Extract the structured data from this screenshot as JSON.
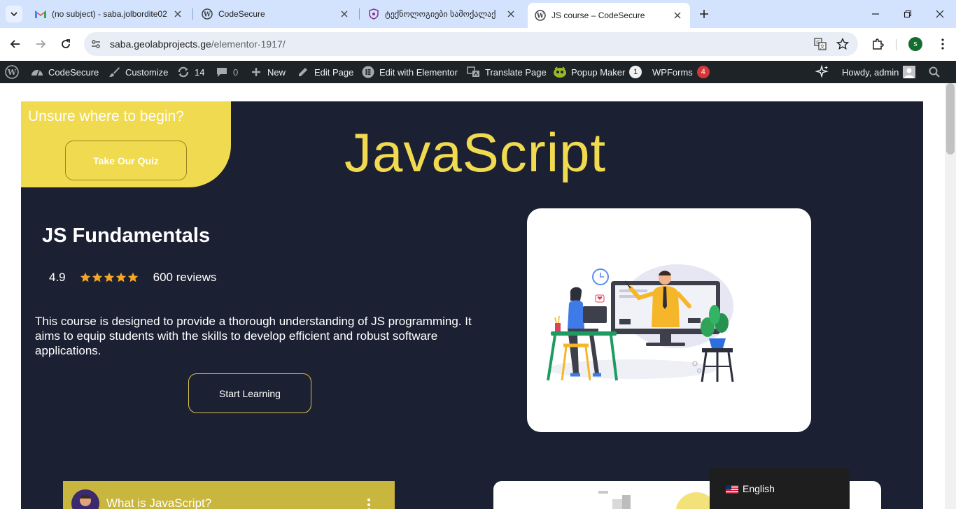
{
  "browser": {
    "tabs": [
      {
        "title": "(no subject) - saba.jolbordite02",
        "favicon": "gmail-icon"
      },
      {
        "title": "CodeSecure",
        "favicon": "wordpress-icon"
      },
      {
        "title": "ტექნოლოგიები სამოქალაქ",
        "favicon": "shield-icon"
      },
      {
        "title": "JS course – CodeSecure",
        "favicon": "wordpress-icon",
        "active": true
      }
    ],
    "url_host": "saba.geolabprojects.ge",
    "url_path": "/elementor-1917/",
    "profile_initial": "s"
  },
  "adminbar": {
    "site_name": "CodeSecure",
    "customize": "Customize",
    "updates_count": "14",
    "comments_count": "0",
    "new_label": "New",
    "edit_page": "Edit Page",
    "edit_elementor": "Edit with Elementor",
    "translate_page": "Translate Page",
    "popup_maker": "Popup Maker",
    "popup_maker_badge": "1",
    "wpforms": "WPForms",
    "wpforms_badge": "4",
    "howdy": "Howdy, admin"
  },
  "page": {
    "quiz_heading": "Unsure where to begin?",
    "quiz_button": "Take Our Quiz",
    "title": "JavaScript",
    "course_title": "JS Fundamentals",
    "rating": "4.9",
    "stars": 5,
    "reviews": "600 reviews",
    "description": "This course is designed to provide a thorough understanding of JS programming. It aims to equip students with the skills to develop efficient and robust software applications.",
    "start_button": "Start Learning",
    "video_title": "What is JavaScript?",
    "language": "English"
  },
  "colors": {
    "hero_bg": "#1c2033",
    "accent_yellow": "#f0da4f",
    "star_orange": "#f5a623",
    "adminbar_bg": "#1d2327"
  }
}
